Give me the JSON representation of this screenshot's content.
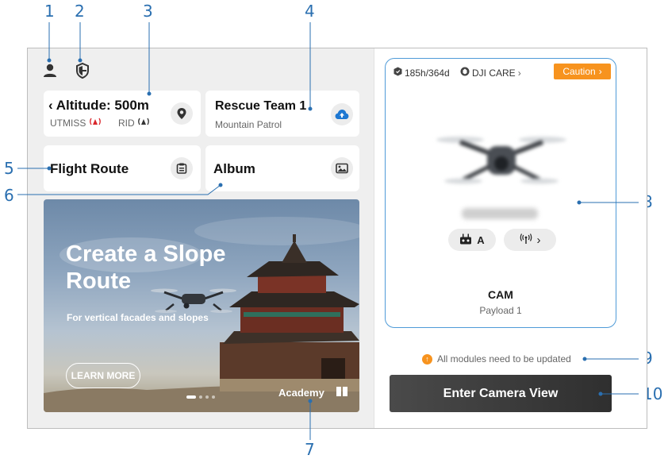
{
  "callouts": [
    "1",
    "2",
    "3",
    "4",
    "5",
    "6",
    "7",
    "8",
    "9",
    "10"
  ],
  "colors": {
    "accent": "#2a6fb0",
    "highlight_border": "#4f9bd8",
    "caution": "#f7931e",
    "alert_red": "#d9262b",
    "button_dark": "#3a3a3a"
  },
  "top_bar": {
    "account_icon": "person-icon",
    "safety_icon": "shield-icon"
  },
  "cards": {
    "altitude": {
      "title": "‹ Altitude: 500m",
      "utmiss_label": "UTMISS",
      "rid_label": "RID",
      "icon": "location-pin-icon"
    },
    "team": {
      "title": "Rescue Team 1",
      "subtitle": "Mountain Patrol",
      "icon": "cloud-upload-icon"
    },
    "flight_route": {
      "title": "Flight Route",
      "icon": "route-list-icon"
    },
    "album": {
      "title": "Album",
      "icon": "image-icon"
    }
  },
  "banner": {
    "title": "Create a Slope Route",
    "subtitle": "For vertical facades and slopes",
    "learn_more": "LEARN MORE",
    "academy": "Academy",
    "academy_icon": "book-icon",
    "page_count": 4,
    "active_page": 1
  },
  "aircraft": {
    "flight_stats": "185h/364d",
    "care_label": "DJI CARE",
    "caution_label": "Caution",
    "remote_label": "A",
    "remote_icon": "remote-controller-icon",
    "signal_icon": "antenna-signal-icon",
    "payload_name": "CAM",
    "payload_sub": "Payload 1"
  },
  "notice": {
    "text": "All modules need to be updated",
    "icon": "warning-dot-icon"
  },
  "enter_camera": "Enter Camera View"
}
